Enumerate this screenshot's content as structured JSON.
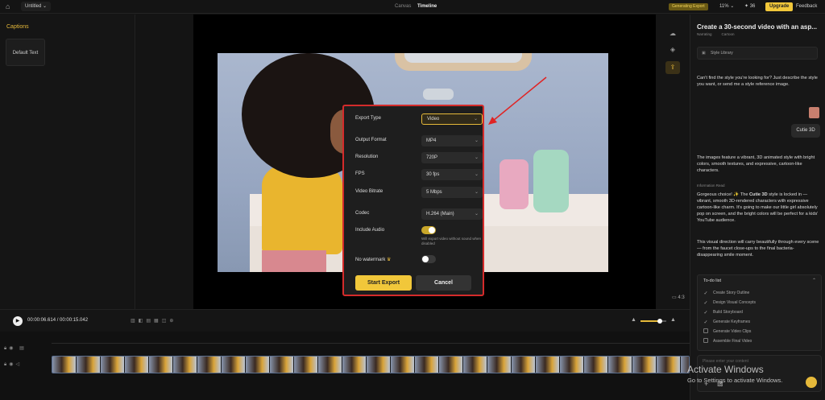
{
  "topbar": {
    "project": "Untitled",
    "tabs": [
      "Canvas",
      "Timeline"
    ],
    "credits_badge": "Generating Export",
    "zoom": "11%",
    "credits": "36",
    "upgrade": "Upgrade",
    "feedback": "Feedback"
  },
  "left_panel": {
    "title": "Captions",
    "card": "Default Text"
  },
  "stage": {
    "ratio": "4:3"
  },
  "export_dialog": {
    "rows": [
      {
        "label": "Export Type",
        "value": "Video"
      },
      {
        "label": "Output Format",
        "value": "MP4"
      },
      {
        "label": "Resolution",
        "value": "720P"
      },
      {
        "label": "FPS",
        "value": "30 fps"
      },
      {
        "label": "Video Bitrate",
        "value": "5 Mbps"
      },
      {
        "label": "Codec",
        "value": "H.264 (Main)"
      }
    ],
    "include_audio_label": "Include Audio",
    "include_audio_on": true,
    "audio_hint": "Will export video without sound when disabled",
    "watermark_label": "No watermark",
    "watermark_on": false,
    "start_export": "Start Export",
    "cancel": "Cancel"
  },
  "right_panel": {
    "title": "Create a 30-second video with an asp...",
    "tags": [
      "Narrating",
      "Cartoon"
    ],
    "style_library": "Style Library",
    "prompt_text": "Can't find the style you're looking for? Just describe the style you want, or send me a style reference image.",
    "user_bubble": "Cutie 3D",
    "reply_1": "The images feature a vibrant, 3D animated style with bright colors, smooth textures, and expressive, cartoon-like characters.",
    "info_label": "Information Read",
    "reply_2_pre": "Gorgeous choice! ✨ The ",
    "reply_2_bold": "Cutie 3D",
    "reply_2_post": " style is locked in — vibrant, smooth 3D-rendered characters with expressive cartoon-like charm. It's going to make our little girl absolutely pop on screen, and the bright colors will be perfect for a kids' YouTube audience.",
    "reply_3": "This visual direction will carry beautifully through every scene — from the faucet close-ups to the final bacteria-disappearing smile moment.",
    "todo_title": "To-do list",
    "todo_items": [
      {
        "label": "Create Story Outline",
        "done": true
      },
      {
        "label": "Design Visual Concepts",
        "done": true
      },
      {
        "label": "Build Storyboard",
        "done": true
      },
      {
        "label": "Generate Keyframes",
        "done": true
      },
      {
        "label": "Generate Video Clips",
        "done": false
      },
      {
        "label": "Assemble Final Video",
        "done": false
      }
    ],
    "chat_placeholder": "Please enter your content"
  },
  "controls": {
    "time": "00:00:06.614 / 00:00:15.042",
    "volume": 0.75
  },
  "watermark": {
    "line1": "Activate Windows",
    "line2": "Go to Settings to activate Windows."
  },
  "colors": {
    "accent": "#f1c73a",
    "highlight_border": "#d42b2b",
    "panel": "#171717"
  }
}
